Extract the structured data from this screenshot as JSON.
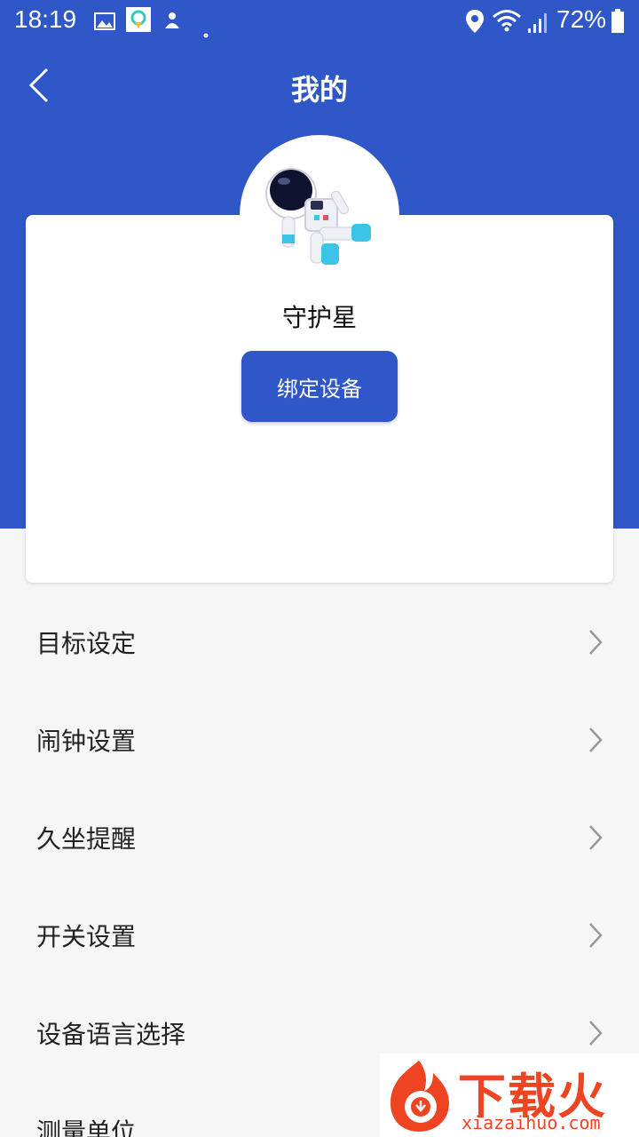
{
  "status_bar": {
    "time": "18:19",
    "battery": "72%",
    "icons": [
      "image-icon",
      "app-icon",
      "notification-icon",
      "dot-icon",
      "location-icon",
      "wifi-icon",
      "signal-icon",
      "battery-icon"
    ]
  },
  "header": {
    "title": "我的",
    "back_icon": "chevron-left-icon"
  },
  "profile": {
    "username": "守护星",
    "bind_button": "绑定设备",
    "avatar": "astronaut-avatar"
  },
  "menu": {
    "items": [
      {
        "label": "目标设定"
      },
      {
        "label": "闹钟设置"
      },
      {
        "label": "久坐提醒"
      },
      {
        "label": "开关设置"
      },
      {
        "label": "设备语言选择"
      },
      {
        "label": "测量单位"
      }
    ]
  },
  "watermark": {
    "brand_cn": "下载火",
    "brand_en": "xiazaihuo.com"
  },
  "colors": {
    "primary": "#2f57c8",
    "background": "#f6f6f6",
    "watermark": "#ee4422"
  }
}
